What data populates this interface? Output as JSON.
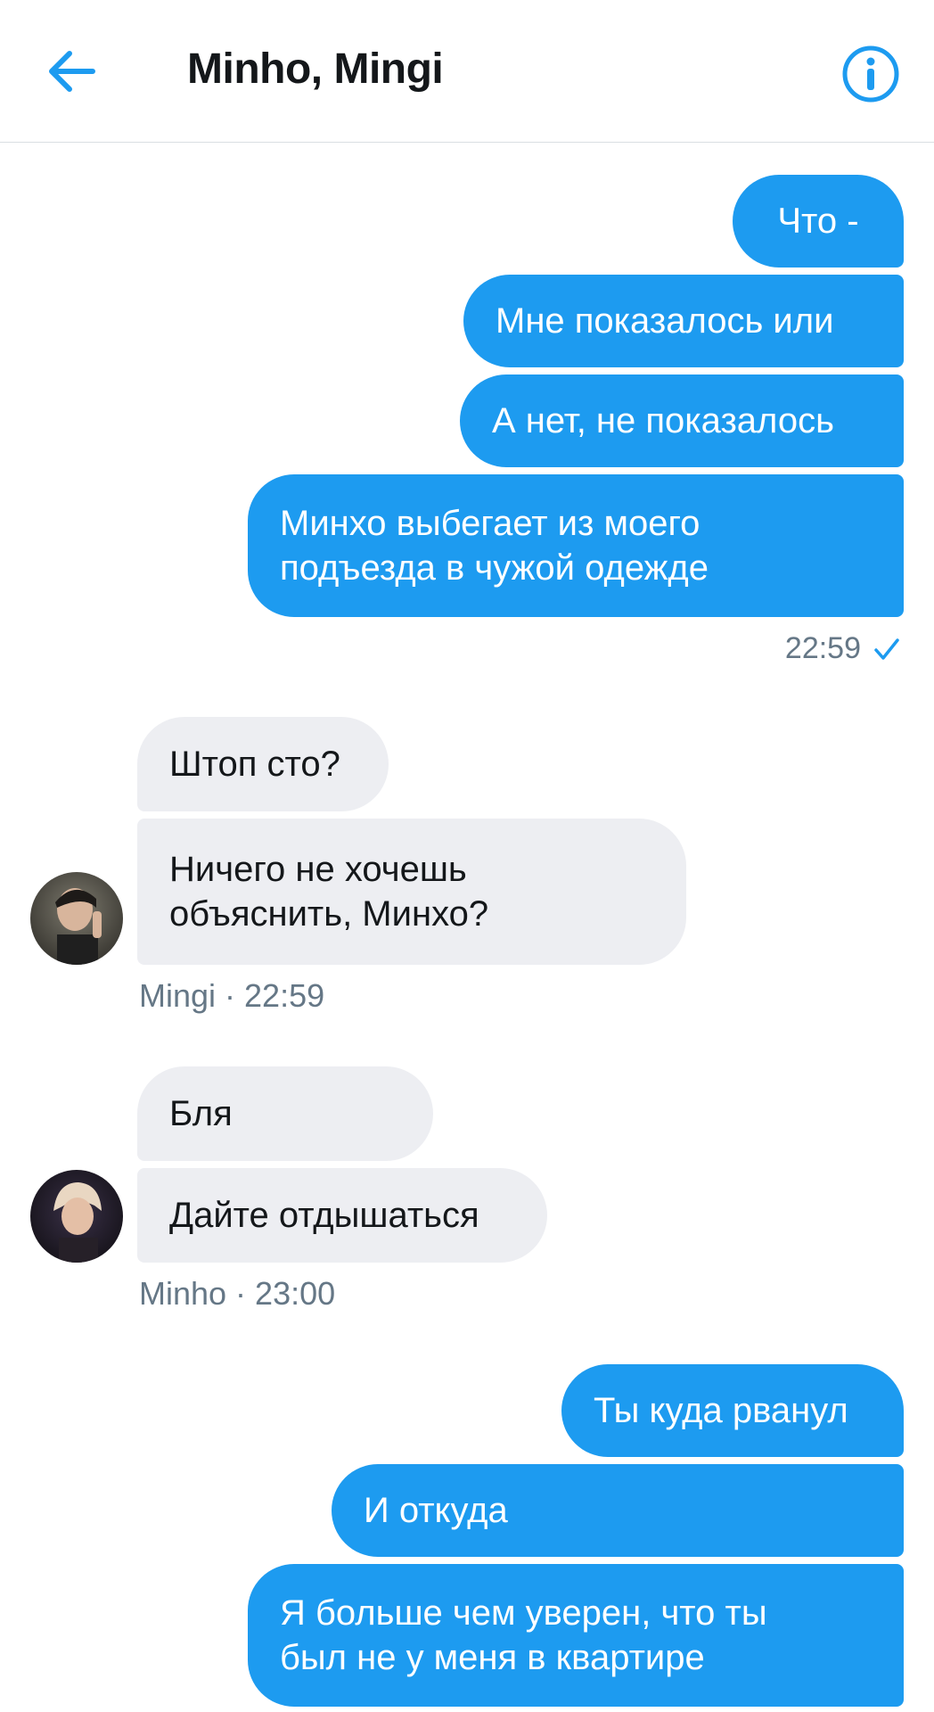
{
  "header": {
    "title": "Minho, Mingi",
    "back_icon": "arrow-left-icon",
    "info_icon": "info-circle-icon",
    "accent": "#1d9bf0"
  },
  "messages": [
    {
      "from": "me",
      "text": "Что -"
    },
    {
      "from": "me",
      "text": "Мне показалось или"
    },
    {
      "from": "me",
      "text": "А нет, не показалось"
    },
    {
      "from": "me",
      "text": "Минхо выбегает из моего подъезда в чужой одежде"
    },
    {
      "from": "Mingi",
      "text": "Штоп сто?"
    },
    {
      "from": "Mingi",
      "text": "Ничего не хочешь объяснить, Минхо?"
    },
    {
      "from": "Minho",
      "text": "Бля"
    },
    {
      "from": "Minho",
      "text": "Дайте отдышаться"
    },
    {
      "from": "me",
      "text": "Ты куда рванул"
    },
    {
      "from": "me",
      "text": "И откуда"
    },
    {
      "from": "me",
      "text": "Я больше чем уверен, что ты был не у меня в квартире"
    }
  ],
  "meta": {
    "group1_time": "22:59",
    "group1_status_icon": "check-icon",
    "mingi_label": "Mingi · 22:59",
    "minho_label": "Minho · 23:00"
  },
  "colors": {
    "outgoing_bubble": "#1d9bf0",
    "incoming_bubble": "#edeef2",
    "meta_text": "#657786"
  }
}
